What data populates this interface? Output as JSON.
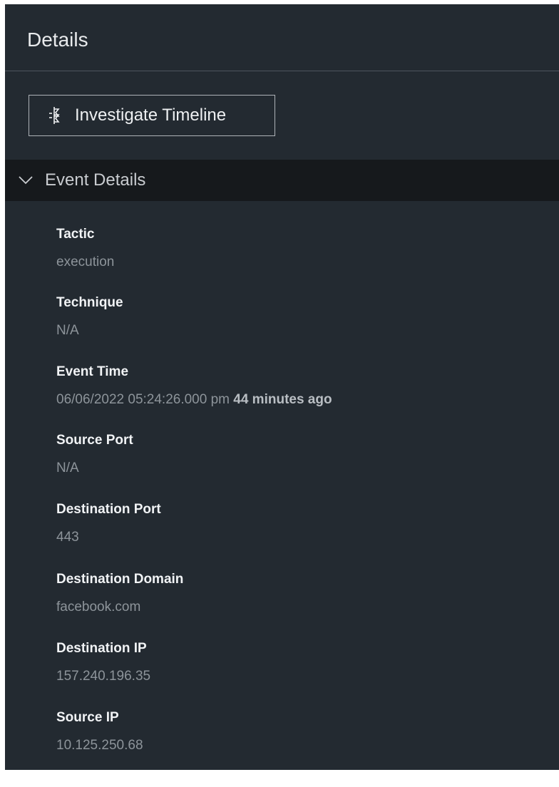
{
  "panel": {
    "title": "Details",
    "investigate_button": {
      "label": "Investigate Timeline",
      "icon": "timeline-icon"
    },
    "section": {
      "label": "Event Details",
      "expanded": true,
      "icon": "chevron-down-icon"
    },
    "fields": [
      {
        "label": "Tactic",
        "value": "execution"
      },
      {
        "label": "Technique",
        "value": "N/A"
      },
      {
        "label": "Event Time",
        "value": "06/06/2022 05:24:26.000 pm",
        "relative": "44 minutes ago"
      },
      {
        "label": "Source Port",
        "value": "N/A"
      },
      {
        "label": "Destination Port",
        "value": "443"
      },
      {
        "label": "Destination Domain",
        "value": "facebook.com"
      },
      {
        "label": "Destination IP",
        "value": "157.240.196.35"
      },
      {
        "label": "Source IP",
        "value": "10.125.250.68"
      }
    ]
  },
  "colors": {
    "panel_bg": "#232a31",
    "section_bar_bg": "#16191c",
    "label_text": "#f1f3f5",
    "value_text": "#8d949a"
  }
}
